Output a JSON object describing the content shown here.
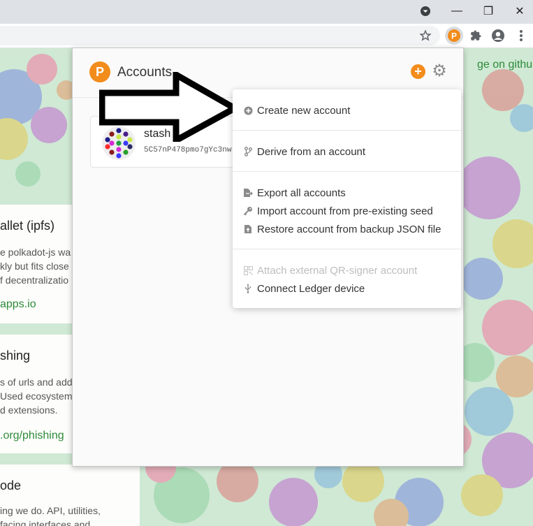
{
  "browser": {
    "window_controls": {
      "minimize": "—",
      "restore": "❐",
      "close": "✕"
    }
  },
  "background_page": {
    "github_link": "ge on github",
    "cards": [
      {
        "title": "allet (ipfs)",
        "lines": [
          "e polkadot-js wa",
          "kly but fits close",
          "f decentralizatio"
        ],
        "link": "apps.io"
      },
      {
        "title": "shing",
        "lines": [
          "s of urls and add",
          "Used ecosystem",
          "d extensions."
        ],
        "link": ".org/phishing"
      },
      {
        "title": "ode",
        "lines": [
          "ing we do. API, utilities,",
          "facing interfaces and"
        ],
        "link": ""
      }
    ]
  },
  "popup": {
    "header": {
      "logo": "P",
      "title": "Accounts",
      "add_icon": "+",
      "settings_icon": "⚙"
    },
    "account": {
      "name": "stash",
      "address": "5C57nP478pmo7gYc3nw"
    },
    "menu": {
      "groups": [
        [
          {
            "label": "Create new account",
            "icon": "plus-circle-icon",
            "enabled": true
          }
        ],
        [
          {
            "label": "Derive from an account",
            "icon": "code-branch-icon",
            "enabled": true
          }
        ],
        [
          {
            "label": "Export all accounts",
            "icon": "file-export-icon",
            "enabled": true
          },
          {
            "label": "Import account from pre-existing seed",
            "icon": "key-icon",
            "enabled": true
          },
          {
            "label": "Restore account from backup JSON file",
            "icon": "file-upload-icon",
            "enabled": true
          }
        ],
        [
          {
            "label": "Attach external QR-signer account",
            "icon": "qrcode-icon",
            "enabled": false
          },
          {
            "label": "Connect Ledger device",
            "icon": "usb-icon",
            "enabled": true
          }
        ]
      ]
    }
  },
  "colors": {
    "accent": "#f28c1b",
    "link": "#2e8b3a",
    "page_bg": "#cfe9d4"
  }
}
